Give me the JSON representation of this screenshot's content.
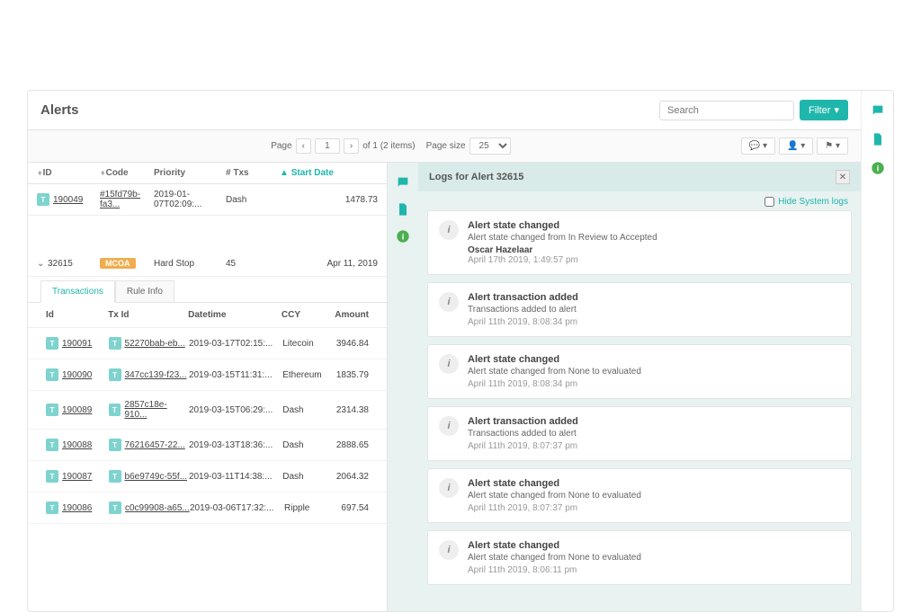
{
  "header": {
    "title": "Alerts",
    "search_placeholder": "Search",
    "filter_label": "Filter"
  },
  "pager": {
    "page_label": "Page",
    "current": "1",
    "total_label": "of 1 (2 items)",
    "size_label": "Page size",
    "size": "25"
  },
  "columns": {
    "id": "ID",
    "code": "Code",
    "priority": "Priority",
    "txs": "# Txs",
    "start_date": "Start Date"
  },
  "row_prev": {
    "id": "190049",
    "code": "#15fd79b-fa3...",
    "pri": "2019-01-07T02:09:...",
    "txs": "Dash",
    "date": "1478.73"
  },
  "expanded": {
    "id": "32615",
    "badge": "MCOA",
    "priority": "Hard Stop",
    "txs": "45",
    "date": "Apr 11, 2019"
  },
  "tabs": {
    "transactions": "Transactions",
    "rule_info": "Rule Info"
  },
  "tx_head": {
    "id": "Id",
    "txid": "Tx Id",
    "datetime": "Datetime",
    "ccy": "CCY",
    "amount": "Amount"
  },
  "tx_rows": [
    {
      "id": "190091",
      "txid": "52270bab-eb...",
      "dt": "2019-03-17T02:15:...",
      "ccy": "Litecoin",
      "amt": "3946.84"
    },
    {
      "id": "190090",
      "txid": "347cc139-f23...",
      "dt": "2019-03-15T11:31:...",
      "ccy": "Ethereum",
      "amt": "1835.79"
    },
    {
      "id": "190089",
      "txid": "2857c18e-910...",
      "dt": "2019-03-15T06:29:...",
      "ccy": "Dash",
      "amt": "2314.38"
    },
    {
      "id": "190088",
      "txid": "76216457-22...",
      "dt": "2019-03-13T18:36:...",
      "ccy": "Dash",
      "amt": "2888.65"
    },
    {
      "id": "190087",
      "txid": "b6e9749c-55f...",
      "dt": "2019-03-11T14:38:...",
      "ccy": "Dash",
      "amt": "2064.32"
    },
    {
      "id": "190086",
      "txid": "c0c99908-a65...",
      "dt": "2019-03-06T17:32:...",
      "ccy": "Ripple",
      "amt": "697.54"
    }
  ],
  "logs": {
    "title": "Logs for Alert 32615",
    "hide_label": "Hide System logs",
    "items": [
      {
        "title": "Alert state changed",
        "desc": "Alert state changed from In Review to Accepted",
        "user": "Oscar Hazelaar",
        "time": "April 17th 2019, 1:49:57 pm"
      },
      {
        "title": "Alert transaction added",
        "desc": "Transactions added to alert",
        "time": "April 11th 2019, 8:08:34 pm"
      },
      {
        "title": "Alert state changed",
        "desc": "Alert state changed from None to evaluated",
        "time": "April 11th 2019, 8:08:34 pm"
      },
      {
        "title": "Alert transaction added",
        "desc": "Transactions added to alert",
        "time": "April 11th 2019, 8:07:37 pm"
      },
      {
        "title": "Alert state changed",
        "desc": "Alert state changed from None to evaluated",
        "time": "April 11th 2019, 8:07:37 pm"
      },
      {
        "title": "Alert state changed",
        "desc": "Alert state changed from None to evaluated",
        "time": "April 11th 2019, 8:06:11 pm"
      }
    ]
  },
  "icons": {
    "t": "T"
  }
}
